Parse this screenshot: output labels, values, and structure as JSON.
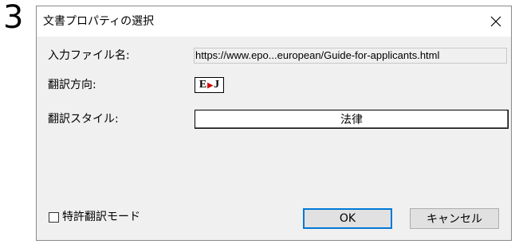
{
  "step_number": "3",
  "dialog": {
    "title": "文書プロパティの選択",
    "close_symbol": "✕",
    "fields": {
      "input_file_label": "入力ファイル名:",
      "input_file_value": "https://www.epo...european/Guide-for-applicants.html",
      "direction_label": "翻訳方向:",
      "direction_from": "E",
      "direction_to": "J",
      "style_label": "翻訳スタイル:",
      "style_value": "法律"
    },
    "patent_mode_checkbox": {
      "label": "特許翻訳モード",
      "checked": false
    },
    "buttons": {
      "ok": "OK",
      "cancel": "キャンセル"
    }
  }
}
